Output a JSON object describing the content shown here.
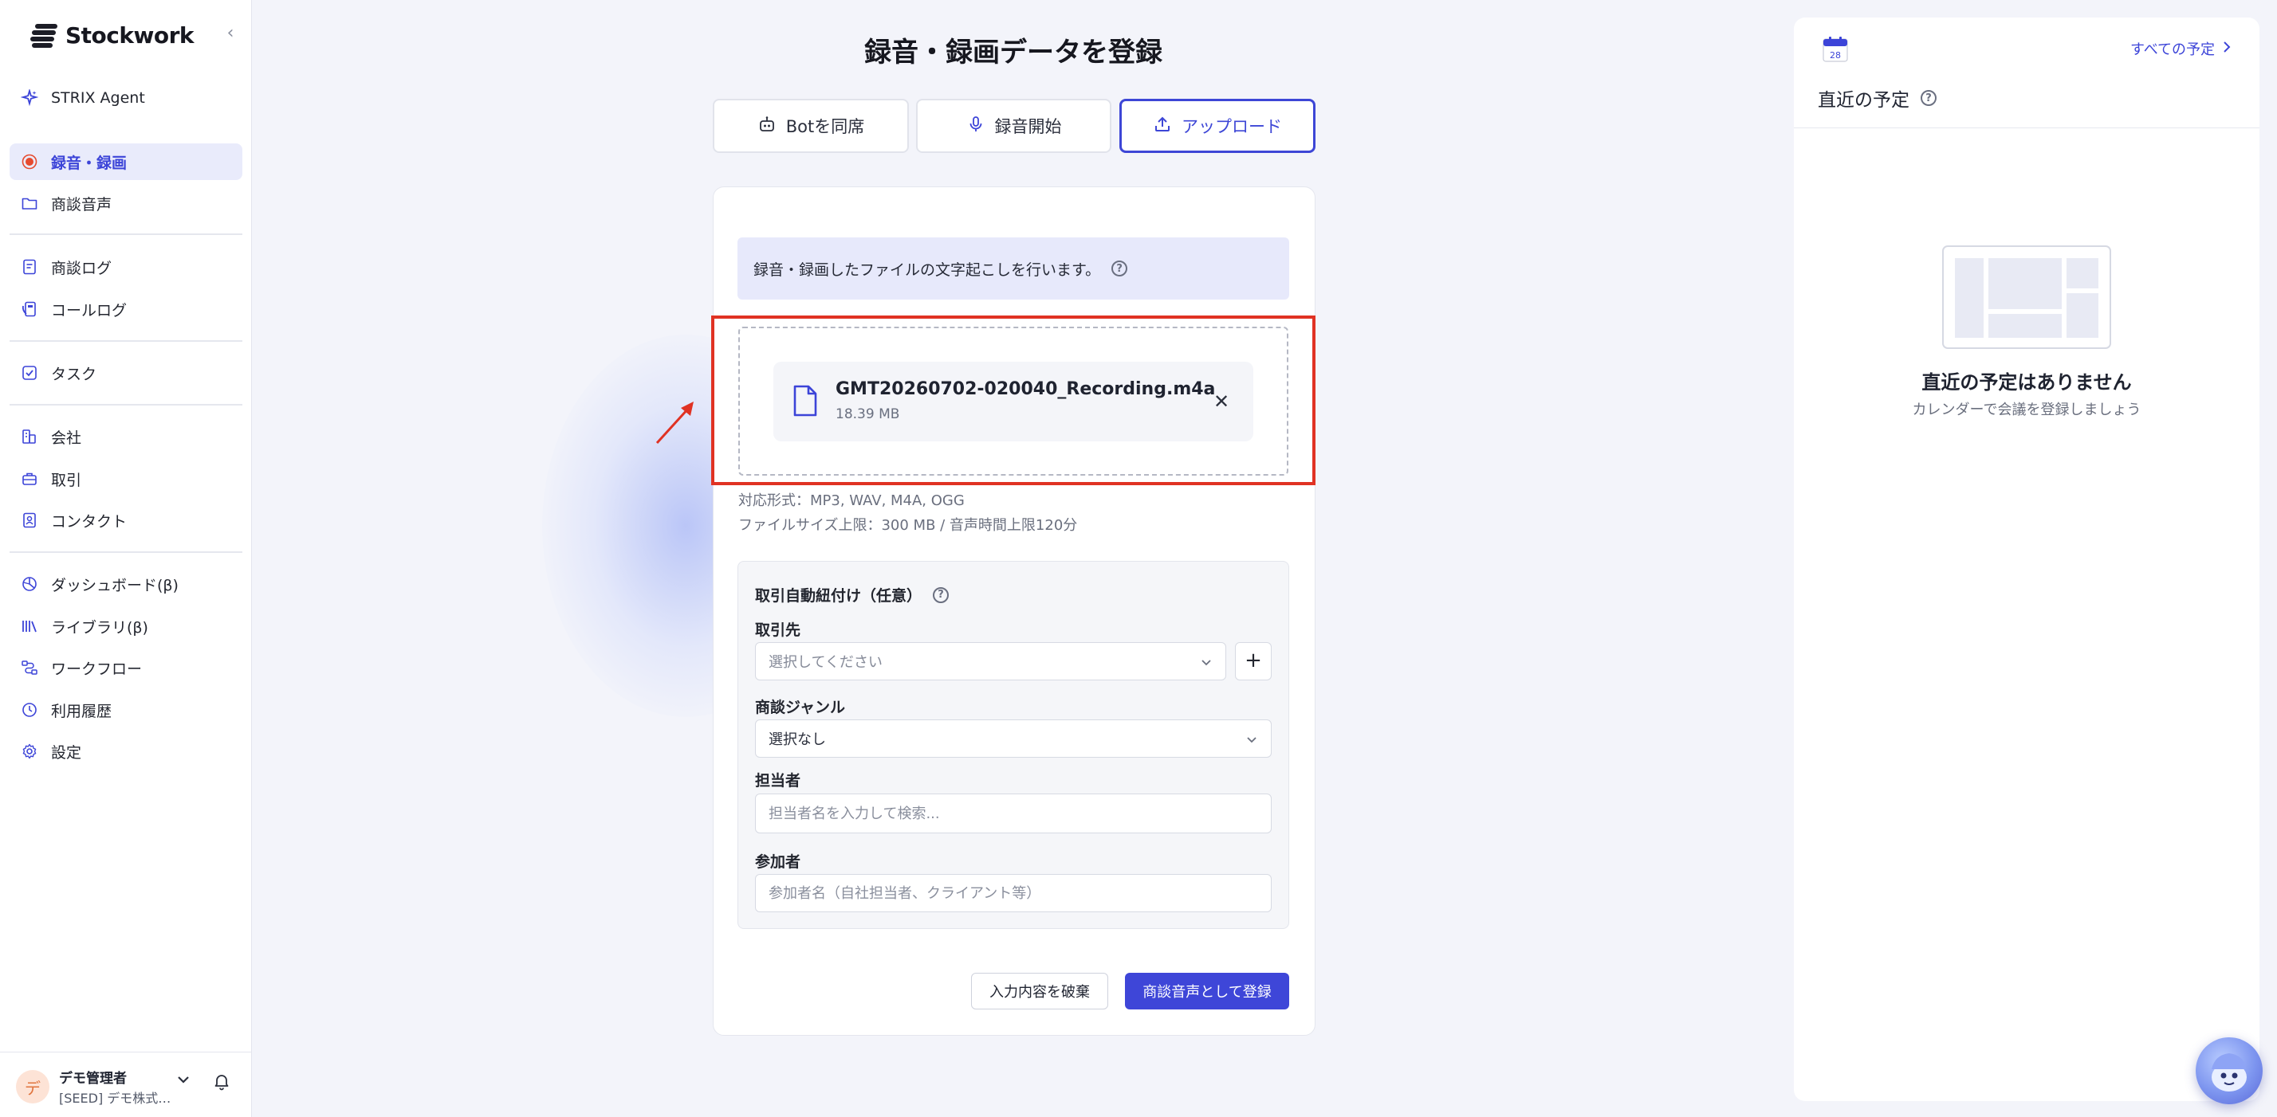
{
  "app": {
    "logo_text": "Stockwork"
  },
  "sidebar": {
    "items": [
      {
        "label": "STRIX Agent",
        "icon": "sparkle-icon"
      },
      {
        "label": "録音・録画",
        "icon": "record-dot-icon",
        "active": true
      },
      {
        "label": "商談音声",
        "icon": "folder-icon"
      },
      {
        "label": "商談ログ",
        "icon": "document-icon"
      },
      {
        "label": "コールログ",
        "icon": "phone-log-icon"
      },
      {
        "label": "タスク",
        "icon": "checkbox-icon"
      },
      {
        "label": "会社",
        "icon": "building-icon"
      },
      {
        "label": "取引",
        "icon": "briefcase-icon"
      },
      {
        "label": "コンタクト",
        "icon": "contact-card-icon"
      },
      {
        "label": "ダッシュボード(β)",
        "icon": "dashboard-icon"
      },
      {
        "label": "ライブラリ(β)",
        "icon": "library-icon"
      },
      {
        "label": "ワークフロー",
        "icon": "workflow-icon"
      },
      {
        "label": "利用履歴",
        "icon": "clock-icon"
      },
      {
        "label": "設定",
        "icon": "gear-icon"
      }
    ],
    "user": {
      "avatar": "デ",
      "name": "デモ管理者",
      "org": "[SEED] デモ株式…"
    }
  },
  "main": {
    "title": "録音・録画データを登録",
    "modes": [
      {
        "label": "Botを同席",
        "icon": "bot-icon"
      },
      {
        "label": "録音開始",
        "icon": "microphone-icon"
      },
      {
        "label": "アップロード",
        "icon": "upload-icon",
        "active": true
      }
    ],
    "banner": "録音・録画したファイルの文字起こしを行います。",
    "file": {
      "name": "GMT20260702-020040_Recording.m4a",
      "size": "18.39 MB"
    },
    "hints": {
      "formats": "対応形式：MP3, WAV, M4A, OGG",
      "limits": "ファイルサイズ上限：300 MB / 音声時間上限120分"
    },
    "form": {
      "section_title": "取引自動紐付け（任意）",
      "deal_label": "取引先",
      "deal_placeholder": "選択してください",
      "genre_label": "商談ジャンル",
      "genre_value": "選択なし",
      "owner_label": "担当者",
      "owner_placeholder": "担当者名を入力して検索...",
      "participants_label": "参加者",
      "participants_placeholder": "参加者名（自社担当者、クライアント等）"
    },
    "actions": {
      "discard": "入力内容を破棄",
      "submit": "商談音声として登録"
    }
  },
  "right_panel": {
    "calendar_day": "28",
    "all_link": "すべての予定",
    "title": "直近の予定",
    "empty_title": "直近の予定はありません",
    "empty_sub": "カレンダーで会議を登録しましょう"
  },
  "colors": {
    "accent": "#3e46d8",
    "highlight_frame": "#e03223",
    "active_nav_bg": "#e9ebfb"
  }
}
